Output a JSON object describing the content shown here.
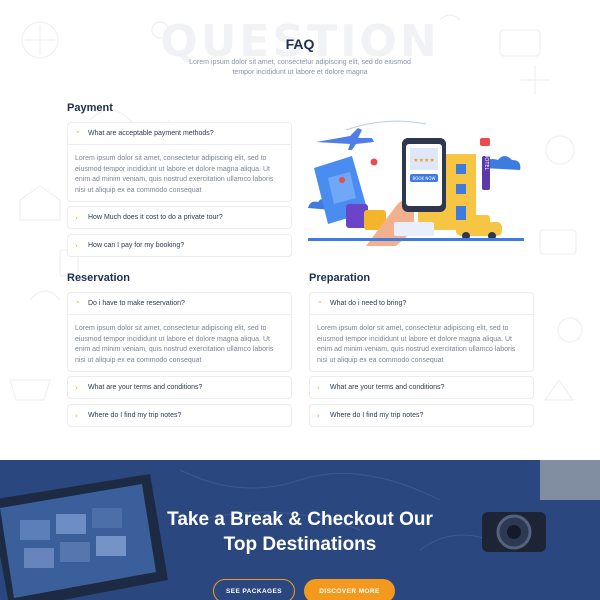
{
  "header": {
    "bg_word": "QUESTION",
    "title": "FAQ",
    "subtitle": "Lorem ipsum dolor sit amet, consectetur adipiscing elit, sed do eiusmod tempor incididunt ut labore et dolore magna"
  },
  "sections": {
    "payment": {
      "title": "Payment",
      "open_question": "What are acceptable payment methods?",
      "answer": "Lorem ipsum dolor sit amet, consectetur adipiscing elit, sed to eiusmod tempor incididunt ut labore et dolore magna aliqua. Ut enim ad minim veniam, quis nostrud exercitation ullamco laboris nisi ut aliquip ex ea commodo consequat",
      "q2": "How Much does it cost to do a private tour?",
      "q3": "How can I pay for my booking?"
    },
    "reservation": {
      "title": "Reservation",
      "open_question": "Do i have to make reservation?",
      "answer": "Lorem ipsum dolor sit amet, consectetur adipiscing elit, sed to eiusmod tempor incididunt ut labore et dolore magna aliqua. Ut enim ad minim veniam, quis nostrud exercitation ullamco laboris nisi ut aliquip ex ea commodo consequat",
      "q2": "What are your terms and conditions?",
      "q3": "Where do I find my trip notes?"
    },
    "preparation": {
      "title": "Preparation",
      "open_question": "What do i need to bring?",
      "answer": "Lorem ipsum dolor sit amet, consectetur adipiscing elit, sed to eiusmod tempor incididunt ut labore et dolore magna aliqua. Ut enim ad minim veniam, quis nostrud exercitation ullamco laboris nisi ut aliquip ex ea commodo consequat",
      "q2": "What are your terms and conditions?",
      "q3": "Where do I find my trip notes?"
    }
  },
  "icons": {
    "open": "chevron-up-icon",
    "closed": "chevron-right-icon"
  },
  "illustration": {
    "app_button": "BOOK NOW",
    "hotel_sign": "HOTEL"
  },
  "banner": {
    "line1": "Take a Break & Checkout Our",
    "line2": "Top Destinations",
    "btn_packages": "SEE PACKAGES",
    "btn_discover": "DISCOVER MORE"
  },
  "colors": {
    "accent": "#f39a1e",
    "navy": "#1f2f4f",
    "banner": "#27437a"
  }
}
